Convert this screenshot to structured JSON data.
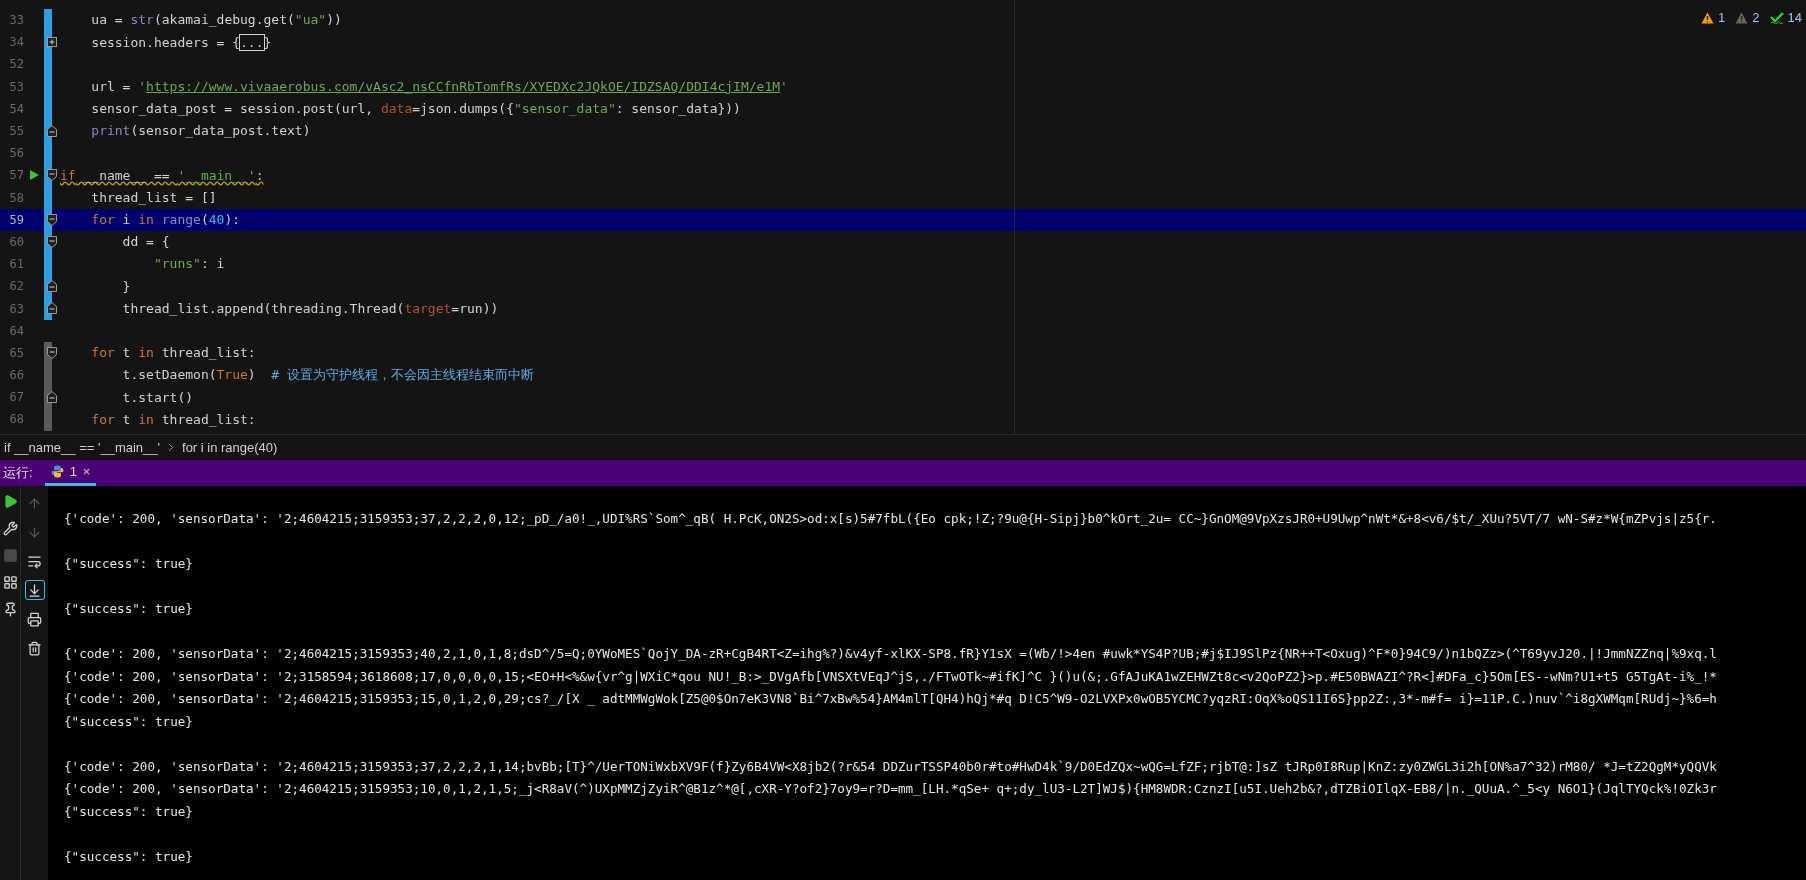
{
  "inspections": [
    {
      "kind": "warning",
      "count": "1"
    },
    {
      "kind": "weak_warning",
      "count": "2"
    },
    {
      "kind": "typo",
      "count": "14"
    }
  ],
  "editor": {
    "lines": [
      {
        "number": "33",
        "change": {
          "kind": "modified"
        },
        "run": false,
        "current": false,
        "warned": false,
        "tokens": [
          {
            "kind": "plain",
            "text": "    ua = "
          },
          {
            "kind": "builtin",
            "text": "str"
          },
          {
            "kind": "plain",
            "text": "(akamai_debug.get("
          },
          {
            "kind": "string",
            "text": "\"ua\""
          },
          {
            "kind": "plain",
            "text": "))"
          }
        ]
      },
      {
        "number": "34",
        "fold": {
          "kind": "collapsed"
        },
        "change": {
          "kind": "modified"
        },
        "run": false,
        "current": false,
        "warned": false,
        "tokens": [
          {
            "kind": "plain",
            "text": "    session.headers = {"
          },
          {
            "kind": "folded",
            "text": "..."
          },
          {
            "kind": "plain",
            "text": "}"
          }
        ]
      },
      {
        "number": "52",
        "change": {
          "kind": "modified"
        },
        "run": false,
        "current": false,
        "warned": false
      },
      {
        "number": "53",
        "change": {
          "kind": "modified"
        },
        "run": false,
        "current": false,
        "warned": false,
        "tokens": [
          {
            "kind": "plain",
            "text": "    url = "
          },
          {
            "kind": "string",
            "text": "'"
          },
          {
            "kind": "link",
            "text": "https://www.vivaaerobus.com/vAsc2_nsCCfnRbTomfRs/XYEDXc2JQkOE/IDZSAQ/DDI4cjIM/e1M"
          },
          {
            "kind": "string",
            "text": "'"
          }
        ]
      },
      {
        "number": "54",
        "change": {
          "kind": "modified"
        },
        "run": false,
        "current": false,
        "warned": false,
        "tokens": [
          {
            "kind": "plain",
            "text": "    sensor_data_post = session.post(url, "
          },
          {
            "kind": "param",
            "text": "data"
          },
          {
            "kind": "plain",
            "text": "=json.dumps({"
          },
          {
            "kind": "string",
            "text": "\"sensor_data\""
          },
          {
            "kind": "plain",
            "text": ": sensor_data}))"
          }
        ]
      },
      {
        "number": "55",
        "fold": {
          "kind": "end"
        },
        "change": {
          "kind": "modified"
        },
        "run": false,
        "current": false,
        "warned": false,
        "tokens": [
          {
            "kind": "builtin",
            "text": "    print"
          },
          {
            "kind": "plain",
            "text": "(sensor_data_post.text)"
          }
        ]
      },
      {
        "number": "56",
        "change": {
          "kind": "modified"
        },
        "run": false,
        "current": false,
        "warned": false
      },
      {
        "number": "57",
        "fold": {
          "kind": "start"
        },
        "change": {
          "kind": "modified"
        },
        "run": true,
        "current": false,
        "warned": true,
        "tokens": [
          {
            "kind": "keyword",
            "text": "if"
          },
          {
            "kind": "plain",
            "text": " __name__ == "
          },
          {
            "kind": "string",
            "text": "'__main__'"
          },
          {
            "kind": "plain",
            "text": ":"
          }
        ]
      },
      {
        "number": "58",
        "change": {
          "kind": "modified"
        },
        "run": false,
        "current": false,
        "warned": false,
        "tokens": [
          {
            "kind": "plain",
            "text": "    thread_list = []"
          }
        ]
      },
      {
        "number": "59",
        "fold": {
          "kind": "start"
        },
        "change": {
          "kind": "modified"
        },
        "run": false,
        "current": true,
        "warned": false,
        "tokens": [
          {
            "kind": "keyword",
            "text": "    for"
          },
          {
            "kind": "plain",
            "text": " i "
          },
          {
            "kind": "keyword",
            "text": "in"
          },
          {
            "kind": "builtin",
            "text": " range"
          },
          {
            "kind": "plain",
            "text": "("
          },
          {
            "kind": "number",
            "text": "40"
          },
          {
            "kind": "plain",
            "text": "):"
          }
        ]
      },
      {
        "number": "60",
        "fold": {
          "kind": "start"
        },
        "change": {
          "kind": "modified"
        },
        "run": false,
        "current": false,
        "warned": false,
        "tokens": [
          {
            "kind": "plain",
            "text": "        dd = {"
          }
        ]
      },
      {
        "number": "61",
        "change": {
          "kind": "modified"
        },
        "run": false,
        "current": false,
        "warned": false,
        "tokens": [
          {
            "kind": "string",
            "text": "            \"runs\""
          },
          {
            "kind": "plain",
            "text": ": i"
          }
        ]
      },
      {
        "number": "62",
        "fold": {
          "kind": "end"
        },
        "change": {
          "kind": "modified"
        },
        "run": false,
        "current": false,
        "warned": false,
        "tokens": [
          {
            "kind": "plain",
            "text": "        }"
          }
        ]
      },
      {
        "number": "63",
        "fold": {
          "kind": "end"
        },
        "change": {
          "kind": "modified"
        },
        "run": false,
        "current": false,
        "warned": false,
        "tokens": [
          {
            "kind": "plain",
            "text": "        thread_list.append(threading.Thread("
          },
          {
            "kind": "param",
            "text": "target"
          },
          {
            "kind": "plain",
            "text": "=run))"
          }
        ]
      },
      {
        "number": "64",
        "run": false,
        "current": false,
        "warned": false
      },
      {
        "number": "65",
        "fold": {
          "kind": "start"
        },
        "change": {
          "kind": "other"
        },
        "run": false,
        "current": false,
        "warned": false,
        "tokens": [
          {
            "kind": "keyword",
            "text": "    for"
          },
          {
            "kind": "plain",
            "text": " t "
          },
          {
            "kind": "keyword",
            "text": "in"
          },
          {
            "kind": "plain",
            "text": " thread_list:"
          }
        ]
      },
      {
        "number": "66",
        "change": {
          "kind": "other"
        },
        "run": false,
        "current": false,
        "warned": false,
        "tokens": [
          {
            "kind": "plain",
            "text": "        t.setDaemon("
          },
          {
            "kind": "keyword",
            "text": "True"
          },
          {
            "kind": "plain",
            "text": ")  "
          },
          {
            "kind": "comment",
            "text": "# 设置为守护线程，不会因主线程结束而中断"
          }
        ]
      },
      {
        "number": "67",
        "fold": {
          "kind": "end"
        },
        "change": {
          "kind": "other"
        },
        "run": false,
        "current": false,
        "warned": false,
        "tokens": [
          {
            "kind": "plain",
            "text": "        t.start()"
          }
        ]
      },
      {
        "number": "68",
        "change": {
          "kind": "other"
        },
        "run": false,
        "current": false,
        "warned": false,
        "tokens": [
          {
            "kind": "keyword",
            "text": "    for"
          },
          {
            "kind": "plain",
            "text": " t "
          },
          {
            "kind": "keyword",
            "text": "in"
          },
          {
            "kind": "plain",
            "text": " thread_list:"
          }
        ]
      }
    ]
  },
  "breadcrumb": [
    "if __name__ == '__main__'",
    "for i in range(40)"
  ],
  "run_panel": {
    "label": "运行:",
    "tabs": [
      {
        "label": "1",
        "selected": true,
        "close": "×"
      }
    ],
    "side_tools": [
      {
        "kind": "run",
        "disabled": false
      },
      {
        "kind": "wrench",
        "disabled": false
      },
      {
        "kind": "stop",
        "disabled": true
      },
      {
        "kind": "layout",
        "disabled": false
      },
      {
        "kind": "pin",
        "disabled": false
      }
    ],
    "console_tools": [
      {
        "kind": "up",
        "disabled": true,
        "selected": false
      },
      {
        "kind": "down",
        "disabled": true,
        "selected": false
      },
      {
        "kind": "wrap",
        "disabled": false,
        "selected": false
      },
      {
        "kind": "scroll_end",
        "disabled": false,
        "selected": true
      },
      {
        "kind": "print",
        "disabled": false,
        "selected": false
      },
      {
        "kind": "trash",
        "disabled": false,
        "selected": false
      }
    ],
    "output": [
      {
        "blank_before": false,
        "text": "{'code': 200, 'sensorData': '2;4604215;3159353;37,2,2,2,0,12;_pD_/a0!_,UDI%RS`Som^_qB( H.PcK,ON2S>od:x[s)5#7fbL({Eo cpk;!Z;?9u@{H-Sipj}b0^kOrt_2u= CC~}GnOM@9VpXzsJR0+U9Uwp^nWt*&+8<v6/$t/_XUu?5VT/7 wN-S#z*W{mZPvjs|z5{r."
      },
      {
        "blank_before": true,
        "text": "{\"success\": true}"
      },
      {
        "blank_before": true,
        "text": "{\"success\": true}"
      },
      {
        "blank_before": true,
        "text": "{'code': 200, 'sensorData': '2;4604215;3159353;40,2,1,0,1,8;dsD^/5=Q;0YWoMES`QojY_DA-zR+CgB4RT<Z=ihg%?)&v4yf-xlKX-SP8.fR}Y1sX =(Wb/!>4en #uwk*YS4P?UB;#j$IJ9SlPz{NR++T<Oxug)^F*0}94C9/)n1bQZz>(^T69yvJ20.|!JmmNZZnq|%9xq.l"
      },
      {
        "blank_before": false,
        "text": "{'code': 200, 'sensorData': '2;3158594;3618608;17,0,0,0,0,15;<EO+H<%&w{vr^g|WXiC*qou NU!_B:>_DVgAfb[VNSXtVEqJ^jS,./FTwOTk~#ifK]^C }()u(&;.GfAJuKA1wZEHWZt8c<v2QoPZ2}>p.#E50BWAZI^?R<]#DFa_c}5Om[ES--wNm?U1+t5 G5TgAt-i%_!*"
      },
      {
        "blank_before": false,
        "text": "{'code': 200, 'sensorData': '2;4604215;3159353;15,0,1,2,0,29;cs?_/[X _ adtMMWgWok[Z5@0$On7eK3VN8`Bi^7xBw%54}AM4mlT[QH4)hQj*#q D!C5^W9-O2LVXPx0wOB5YCMC?yqzRI:OqX%oQS11I6S}pp2Z:,3*-m#f= i}=11P.C.)nuv`^i8gXWMqm[RUdj~}%6=h"
      },
      {
        "blank_before": false,
        "text": "{\"success\": true}"
      },
      {
        "blank_before": true,
        "text": "{'code': 200, 'sensorData': '2;4604215;3159353;37,2,2,2,1,14;bvBb;[T}^/UerTONiWxbXV9F(f}Zy6B4VW<X8jb2(?r&54 DDZurTSSP40b0r#to#HwD4k`9/D0EdZQx~wQG=LfZF;rjbT@:]sZ tJRp0I8Rup|KnZ:zy0ZWGL3i2h[ON%a7^32)rM80/ *J=tZ2QgM*yQQVk"
      },
      {
        "blank_before": false,
        "text": "{'code': 200, 'sensorData': '2;4604215;3159353;10,0,1,2,1,5;_j<R8aV(^)UXpMMZjZyiR^@B1z^*@[,cXR-Y?of2}7oy9=r?D=mm_[LH.*qSe+ q+;dy_lU3-L2T]WJ$){HM8WDR:CznzI[u5I.Ueh2b&?,dTZBiOIlqX-EB8/|n._QUuA.^_5<y N6O1}(JqlTYQck%!0Zk3r"
      },
      {
        "blank_before": false,
        "text": "{\"success\": true}"
      },
      {
        "blank_before": true,
        "text": "{\"success\": true}"
      }
    ]
  }
}
